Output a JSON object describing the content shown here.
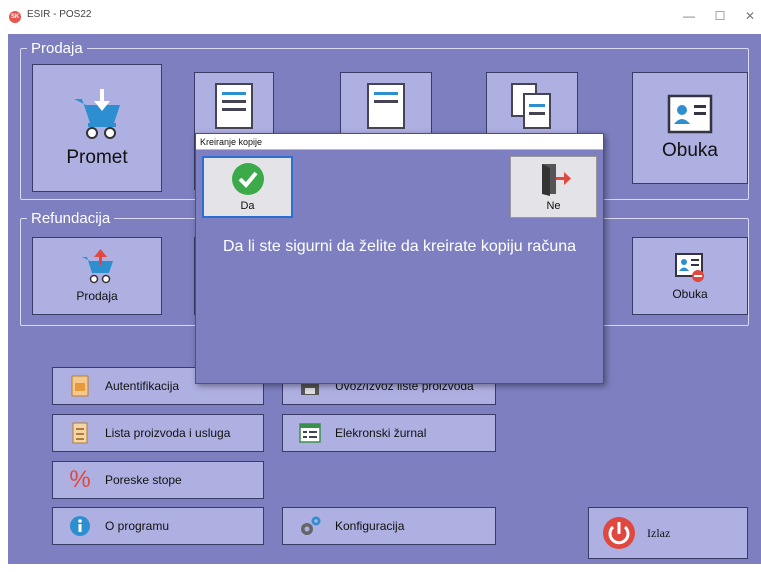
{
  "window": {
    "title": "ESIR - POS22",
    "app_icon_text": "SK",
    "minimize": "—",
    "maximize": "☐",
    "close": "✕"
  },
  "prodaja": {
    "legend": "Prodaja",
    "buttons": [
      {
        "label": "Promet",
        "icon": "cart-download-icon"
      },
      {
        "label": "Obuka",
        "icon": "id-card-icon"
      }
    ]
  },
  "refundacija": {
    "legend": "Refundacija",
    "buttons": [
      {
        "label": "Prodaja",
        "icon": "cart-refund-icon"
      },
      {
        "label": "Obuka",
        "icon": "id-card-remove-icon"
      }
    ]
  },
  "tools": {
    "autentifikacija": "Autentifikacija",
    "uvoz_izvoz": "Uvoz/Izvoz liste proizvoda",
    "lista": "Lista proizvoda i usluga",
    "zurnal": "Elekronski žurnal",
    "poreske": "Poreske stope",
    "o_programu": "O programu",
    "konfiguracija": "Konfiguracija",
    "izlaz": "Izlaz",
    "percent_glyph": "%"
  },
  "dialog": {
    "title": "Kreiranje kopije",
    "yes_label": "Da",
    "no_label": "Ne",
    "message": "Da li ste sigurni da želite da kreirate kopiju računa"
  },
  "colors": {
    "background": "#7d7fc1",
    "button": "#aeb0e2",
    "dialog_button": "#e4e4e8",
    "accent_green": "#3daa4a",
    "accent_red": "#e0473f"
  }
}
